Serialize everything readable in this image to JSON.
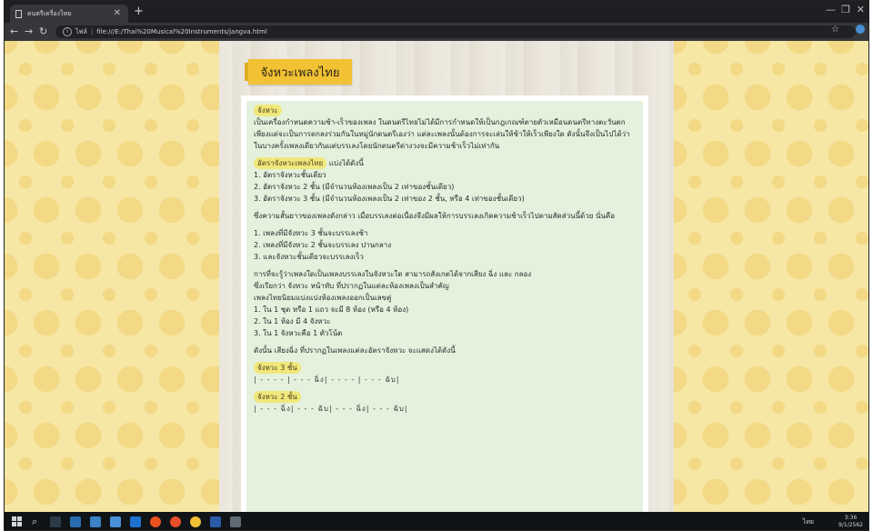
{
  "browser": {
    "tab_title": "ดนตรีเครื่องไทย",
    "url_label": "ไฟล์",
    "url": "file:///E:/Thai%20Musical%20Instruments/jangva.html"
  },
  "page": {
    "title": "จังหวะเพลงไทย",
    "sec1_label": "จังหวะ",
    "sec1_text": "เป็นเครื่องกำหนดความช้า-เร็วของเพลง ในดนตรีไทยไม่ได้มีการกำหนดให้เป็นกฎเกณฑ์ตายตัวเหมือนดนตรีทางตะวันตก เพียงแต่จะเป็นการตกลงร่วมกันในหมู่นักดนตรีเองว่า แต่ละเพลงนั้นต้องการจะเล่นให้ช้าให้เร็วเพียงใด ดังนั้นจึงเป็นไปได้ว่าในบางครั้งเพลงเดียวกันแต่บรรเลงโดยนักดนตรีต่างวงจะมีความช้าเร็วไม่เท่ากัน",
    "sec2_label": "อัตราจังหวะเพลงไทย",
    "sec2_suffix": "แบ่งได้ดังนี้",
    "rates": [
      "1. อัตราจังหวะชั้นเดียว",
      "2. อัตราจังหวะ 2 ชั้น (มีจำนวนห้องเพลงเป็น 2 เท่าของชั้นเดียว)",
      "3. อัตราจังหวะ 3 ชั้น (มีจำนวนห้องเพลงเป็น 2 เท่าของ 2 ชั้น, หรือ 4 เท่าของชั้นเดียว)"
    ],
    "para2": "ซึ่งความสั้นยาวของเพลงดังกล่าว เมื่อบรรเลงต่อเนื่องจึงมีผลให้การบรรเลงเกิดความช้าเร็วไปตามสัดส่วนนี้ด้วย นั่นคือ",
    "speeds": [
      "1. เพลงที่มีจังหวะ 3 ชั้นจะบรรเลงช้า",
      "2. เพลงที่มีจังหวะ 2 ชั้นจะบรรเลง ปานกลาง",
      "3. และจังหวะชั้นเดียวจะบรรเลงเร็ว"
    ],
    "para3_line1": "การที่จะรู้ว่าเพลงใดเป็นเพลงบรรเลงในจังหวะใด สามารถสังเกตได้จากเสียง ฉิ่ง และ กลอง",
    "para3_line2": "ซึ่งเรียกว่า จังหวะ หน้าทับ ที่ปรากฏในแต่ละห้องเพลงเป็นสำคัญ",
    "para4": "เพลงไทยนิยมแบ่งแบ่งห้องเพลงออกเป็นเลขคู่",
    "rules": [
      "1. ใน 1 ชุด หรือ 1 แถว จะมี 8 ห้อง (หรือ 4 ห้อง)",
      "2. ใน 1 ห้อง มี 4 จังหวะ",
      "3. ใน 1 จังหวะคือ 1 ตัวโน้ต"
    ],
    "para5": "ดังนั้น เสียงฉิ่ง ที่ปรากฏในเพลงแต่ละอัตราจังหวะ จะแสดงได้ดังนี้",
    "ex3_label": "จังหวะ 3 ชั้น",
    "ex3_pattern": "| - - - - | - - - ฉิ่ง| - - - - | - - - ฉับ|",
    "ex2_label": "จังหวะ 2 ชั้น",
    "ex2_pattern": "| - - - ฉิ่ง| - - - ฉับ| - - - ฉิ่ง| - - - ฉับ|"
  },
  "taskbar": {
    "time": "3:36",
    "date": "9/1/2562",
    "lang": "ไทย"
  }
}
